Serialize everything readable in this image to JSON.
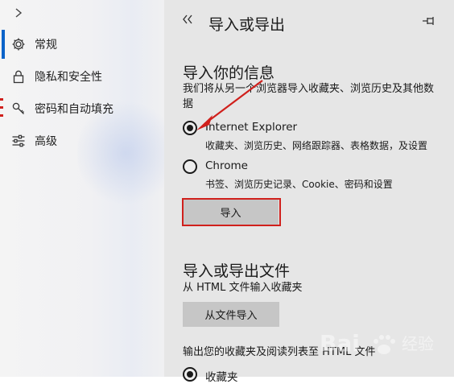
{
  "sidebar": {
    "items": [
      {
        "label": "常规",
        "icon": "gear-icon"
      },
      {
        "label": "隐私和安全性",
        "icon": "lock-icon"
      },
      {
        "label": "密码和自动填充",
        "icon": "key-icon"
      },
      {
        "label": "高级",
        "icon": "sliders-icon"
      }
    ]
  },
  "panel": {
    "title": "导入或导出",
    "import_info": {
      "title": "导入你的信息",
      "description": "我们将从另一个浏览器导入收藏夹、浏览历史及其他数据",
      "options": [
        {
          "label": "Internet Explorer",
          "sub": "收藏夹、浏览历史、网络跟踪器、表格数据，及设置",
          "checked": true
        },
        {
          "label": "Chrome",
          "sub": "书签、浏览历史记录、Cookie、密码和设置",
          "checked": false
        }
      ],
      "import_button": "导入"
    },
    "import_export_file": {
      "title": "导入或导出文件",
      "description": "从 HTML 文件输入收藏夹",
      "import_file_button": "从文件导入",
      "export_description": "输出您的收藏夹及阅读列表至 HTML 文件",
      "export_option": "收藏夹"
    }
  },
  "watermark": {
    "text": "Bai",
    "sub": "经验"
  },
  "colors": {
    "accent": "#0a63c9",
    "annotation_red": "#d0201c",
    "panel_bg": "#e6e6e6",
    "button_bg": "#c6c6c6"
  }
}
